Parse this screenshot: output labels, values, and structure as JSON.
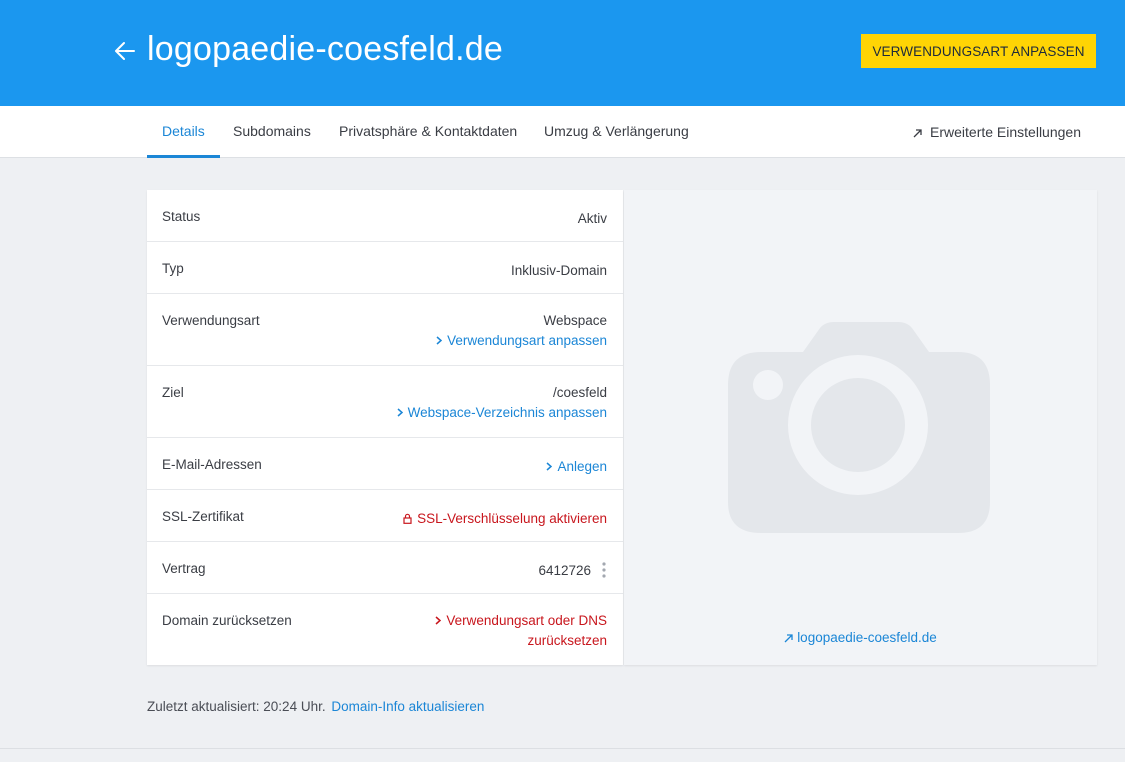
{
  "header": {
    "domain": "logopaedie-coesfeld.de",
    "primary_button": "VERWENDUNGSART ANPASSEN",
    "colors": {
      "bar": "#1b97ef",
      "button": "#ffd404"
    }
  },
  "tabs": [
    {
      "label": "Details",
      "active": true
    },
    {
      "label": "Subdomains",
      "active": false
    },
    {
      "label": "Privatsphäre & Kontaktdaten",
      "active": false
    },
    {
      "label": "Umzug & Verlängerung",
      "active": false
    }
  ],
  "advanced_settings": {
    "label": "Erweiterte Einstellungen",
    "icon": "external-arrow-icon"
  },
  "details": {
    "status": {
      "label": "Status",
      "value": "Aktiv"
    },
    "typ": {
      "label": "Typ",
      "value": "Inklusiv-Domain"
    },
    "verwendungsart": {
      "label": "Verwendungsart",
      "value": "Webspace",
      "action": "Verwendungsart anpassen"
    },
    "ziel": {
      "label": "Ziel",
      "value": "/coesfeld",
      "action": "Webspace-Verzeichnis anpassen"
    },
    "email": {
      "label": "E-Mail-Adressen",
      "action": "Anlegen"
    },
    "ssl": {
      "label": "SSL-Zertifikat",
      "action": "SSL-Verschlüsselung aktivieren",
      "icon": "lock-icon"
    },
    "vertrag": {
      "label": "Vertrag",
      "value": "6412726"
    },
    "reset": {
      "label": "Domain zurücksetzen",
      "action_line1": "Verwendungsart oder DNS",
      "action_line2": "zurücksetzen"
    }
  },
  "preview": {
    "link": "logopaedie-coesfeld.de",
    "icon": "camera-icon"
  },
  "footer": {
    "text": "Zuletzt aktualisiert: 20:24 Uhr.",
    "action": "Domain-Info aktualisieren"
  }
}
